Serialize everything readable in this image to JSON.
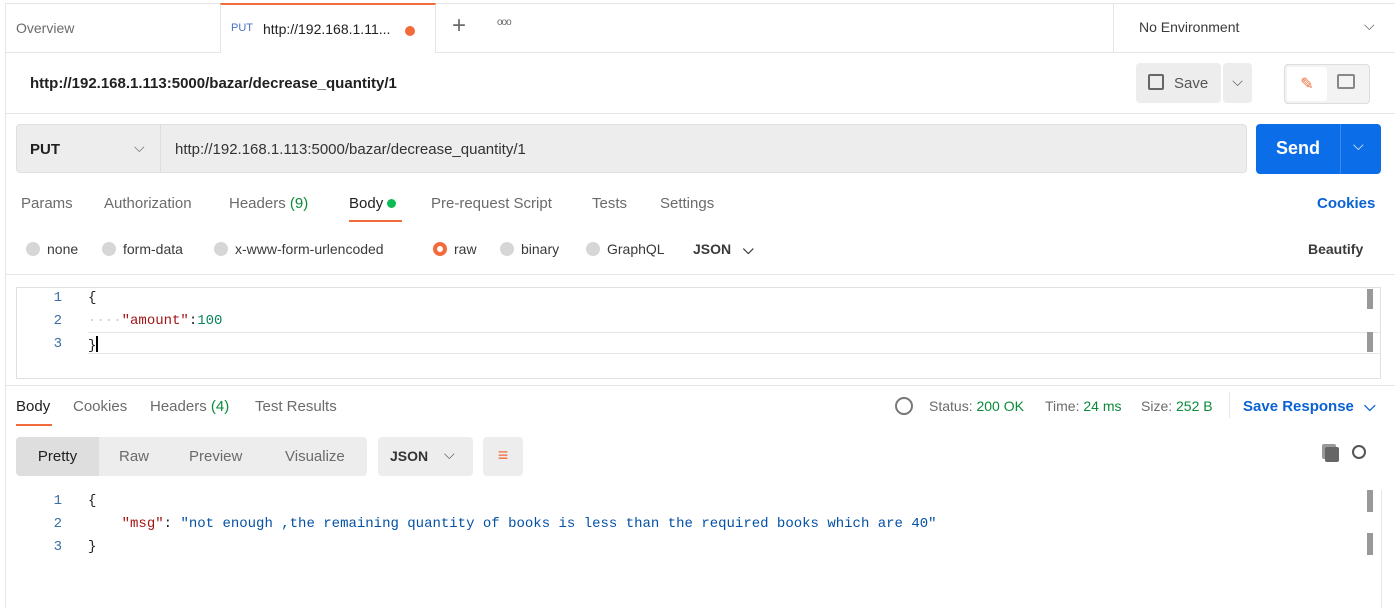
{
  "tabs": {
    "overview": "Overview",
    "active_method": "PUT",
    "active_title": "http://192.168.1.11...",
    "environment": "No Environment"
  },
  "request": {
    "title": "http://192.168.1.113:5000/bazar/decrease_quantity/1",
    "save": "Save",
    "method": "PUT",
    "url": "http://192.168.1.113:5000/bazar/decrease_quantity/1",
    "send": "Send"
  },
  "req_tabs": [
    "Params",
    "Authorization",
    "Headers",
    "Body",
    "Pre-request Script",
    "Tests",
    "Settings"
  ],
  "headers_count": "(9)",
  "cookies": "Cookies",
  "body_options": [
    "none",
    "form-data",
    "x-www-form-urlencoded",
    "raw",
    "binary",
    "GraphQL"
  ],
  "body_format": "JSON",
  "beautify": "Beautify",
  "req_body": {
    "line_numbers": [
      "1",
      "2",
      "3"
    ],
    "open": "{",
    "key": "\"amount\"",
    "colon": ":",
    "value": "100",
    "close": "}"
  },
  "response": {
    "tabs": [
      "Body",
      "Cookies",
      "Headers",
      "Test Results"
    ],
    "headers_count": "(4)",
    "status_label": "Status:",
    "status": "200 OK",
    "time_label": "Time:",
    "time": "24 ms",
    "size_label": "Size:",
    "size": "252 B",
    "save_response": "Save Response",
    "views": [
      "Pretty",
      "Raw",
      "Preview",
      "Visualize"
    ],
    "format": "JSON",
    "line_numbers": [
      "1",
      "2",
      "3"
    ],
    "open": "{",
    "key": "\"msg\"",
    "colon": ": ",
    "value": "\"not enough ,the remaining quantity of books is less than the required books which are 40\"",
    "close": "}"
  }
}
